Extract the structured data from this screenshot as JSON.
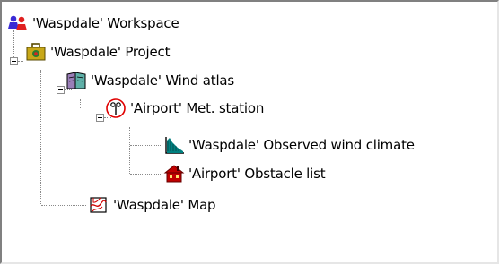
{
  "tree": {
    "workspace": {
      "label": "'Waspdale' Workspace",
      "icon": "workspace-icon"
    },
    "project": {
      "label": "'Waspdale' Project",
      "icon": "project-briefcase-icon"
    },
    "wind_atlas": {
      "label": "'Waspdale' Wind atlas",
      "icon": "wind-atlas-book-icon"
    },
    "met_station": {
      "label": "'Airport' Met. station",
      "icon": "met-station-anemometer-icon"
    },
    "observed_climate": {
      "label": "'Waspdale' Observed wind climate",
      "icon": "observed-wind-climate-histogram-icon"
    },
    "obstacle_list": {
      "label": "'Airport' Obstacle list",
      "icon": "obstacle-list-house-icon"
    },
    "map": {
      "label": "'Waspdale' Map",
      "icon": "map-icon"
    }
  },
  "colors": {
    "tree_line": "#8a8a8a",
    "station_ring": "#e00000",
    "histogram": "#008080",
    "house": "#c00000"
  }
}
